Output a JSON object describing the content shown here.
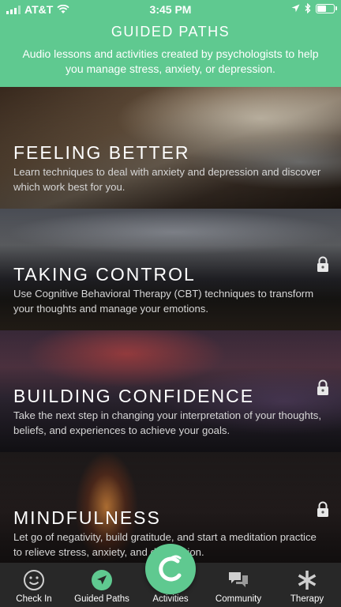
{
  "status": {
    "carrier": "AT&T",
    "time": "3:45 PM",
    "battery_level": 0.6
  },
  "header": {
    "title": "GUIDED PATHS",
    "subtitle": "Audio lessons and activities created by psychologists to help you manage stress, anxiety, or depression."
  },
  "paths": [
    {
      "title": "FEELING BETTER",
      "description": "Learn techniques to deal with anxiety and depression and discover which work best for you.",
      "locked": false
    },
    {
      "title": "TAKING CONTROL",
      "description": "Use Cognitive Behavioral Therapy (CBT) techniques to transform your thoughts and manage your emotions.",
      "locked": true
    },
    {
      "title": "BUILDING CONFIDENCE",
      "description": "Take the next step in changing your interpretation of your thoughts, beliefs, and experiences to achieve your goals.",
      "locked": true
    },
    {
      "title": "MINDFULNESS",
      "description": "Let go of negativity, build gratitude, and start a meditation practice to relieve stress, anxiety, and depression.",
      "locked": true
    }
  ],
  "tabs": {
    "check_in": "Check In",
    "guided_paths": "Guided Paths",
    "activities": "Activities",
    "community": "Community",
    "therapy": "Therapy"
  },
  "colors": {
    "accent": "#5fc990",
    "tabbar": "#282828"
  }
}
